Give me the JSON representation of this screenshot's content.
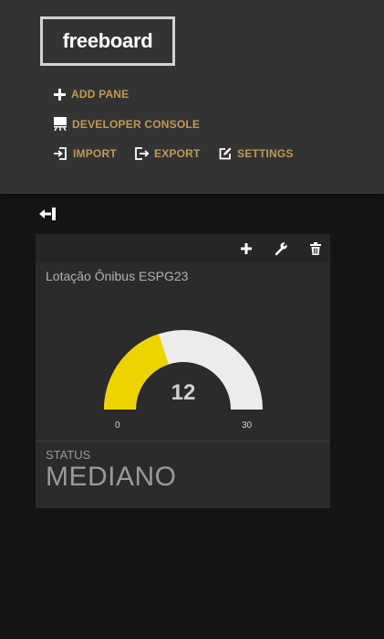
{
  "brand": {
    "logo_text": "freeboard"
  },
  "menu": {
    "add_pane": {
      "label": "ADD PANE",
      "icon": "plus-icon"
    },
    "developer_console": {
      "label": "DEVELOPER CONSOLE",
      "icon": "presentation-icon"
    },
    "import": {
      "label": "IMPORT",
      "icon": "import-icon"
    },
    "export": {
      "label": "EXPORT",
      "icon": "export-icon"
    },
    "settings": {
      "label": "SETTINGS",
      "icon": "edit-icon"
    }
  },
  "pane": {
    "tools": [
      "plus-icon",
      "wrench-icon",
      "trash-icon"
    ],
    "gauge": {
      "title": "Lotação Ônibus ESPG23",
      "value": 12,
      "min": 0,
      "max": 30,
      "value_text": "12",
      "min_text": "0",
      "max_text": "30",
      "fill_color": "#edd400",
      "track_color": "#edebeb"
    },
    "status": {
      "label": "STATUS",
      "value": "MEDIANO"
    }
  },
  "colors": {
    "accent": "#c09a55",
    "header_bg": "#333333",
    "page_bg": "#131416",
    "pane_bg": "#2b2b2b"
  }
}
